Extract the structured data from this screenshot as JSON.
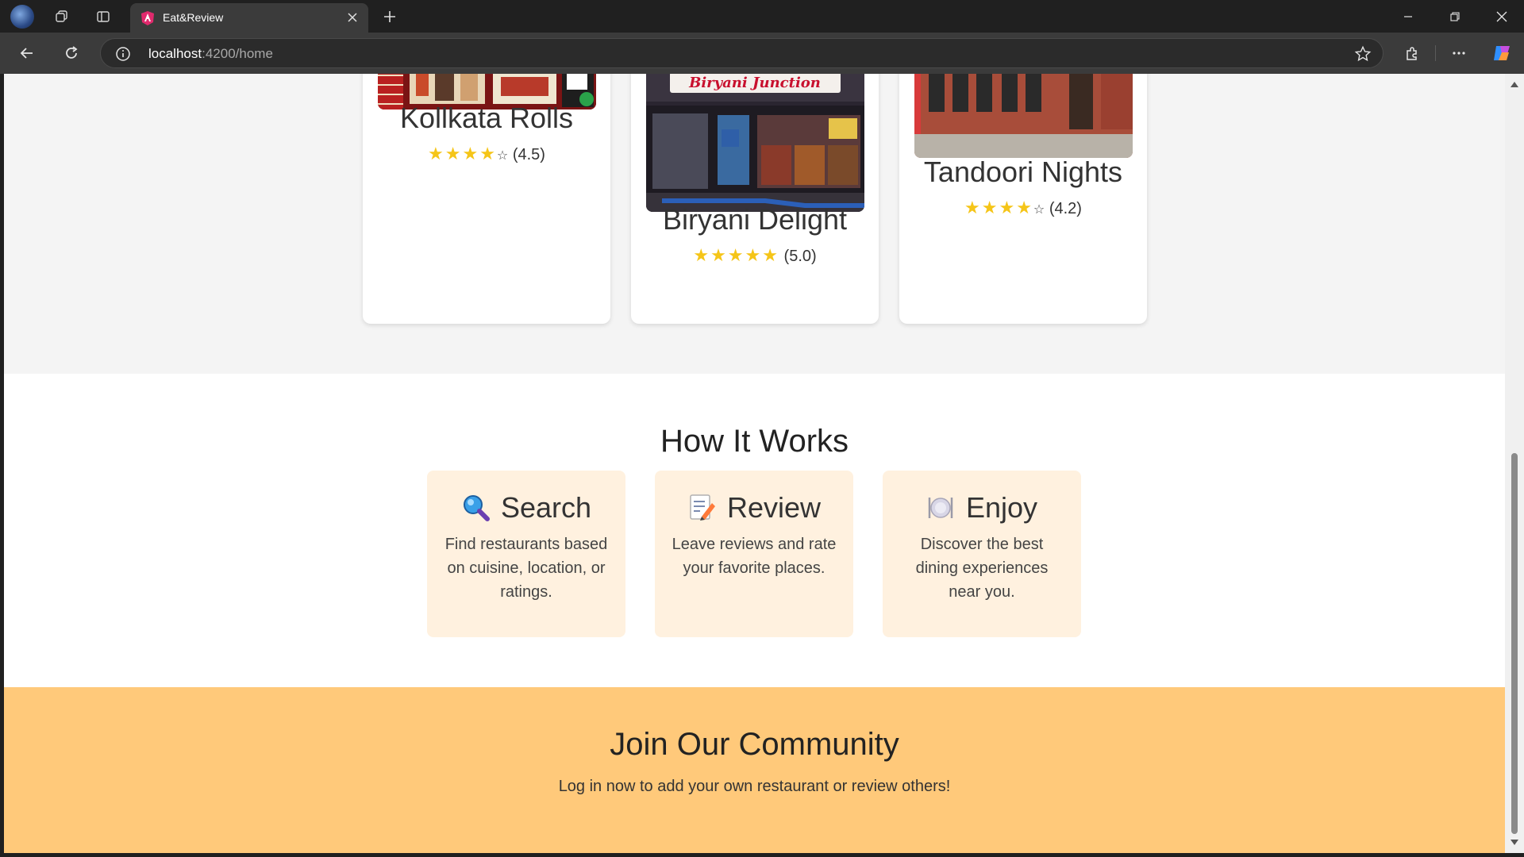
{
  "browser": {
    "tab_title": "Eat&Review",
    "url_host": "localhost",
    "url_path": ":4200/home"
  },
  "restaurants": [
    {
      "name": "Kollkata Rolls",
      "stars": "★★★★",
      "empty_star": "☆",
      "rating": "(4.5)",
      "sign_text": ""
    },
    {
      "name": "Biryani Delight",
      "stars": "★★★★★",
      "empty_star": "",
      "rating": "(5.0)",
      "sign_text": "Biryani Junction"
    },
    {
      "name": "Tandoori Nights",
      "stars": "★★★★",
      "empty_star": "☆",
      "rating": "(4.2)",
      "sign_text": ""
    }
  ],
  "how_it_works": {
    "title": "How It Works",
    "steps": [
      {
        "title": "Search",
        "icon": "magnifier-icon",
        "text": "Find restaurants based on cuisine, location, or ratings."
      },
      {
        "title": "Review",
        "icon": "memo-icon",
        "text": "Leave reviews and rate your favorite places."
      },
      {
        "title": "Enjoy",
        "icon": "plate-icon",
        "text": "Discover the best dining experiences near you."
      }
    ]
  },
  "join": {
    "title": "Join Our Community",
    "text": "Log in now to add your own restaurant or review others!"
  },
  "colors": {
    "star": "#f5c518",
    "step_bg": "#fff1df",
    "join_bg": "#ffc97a"
  }
}
